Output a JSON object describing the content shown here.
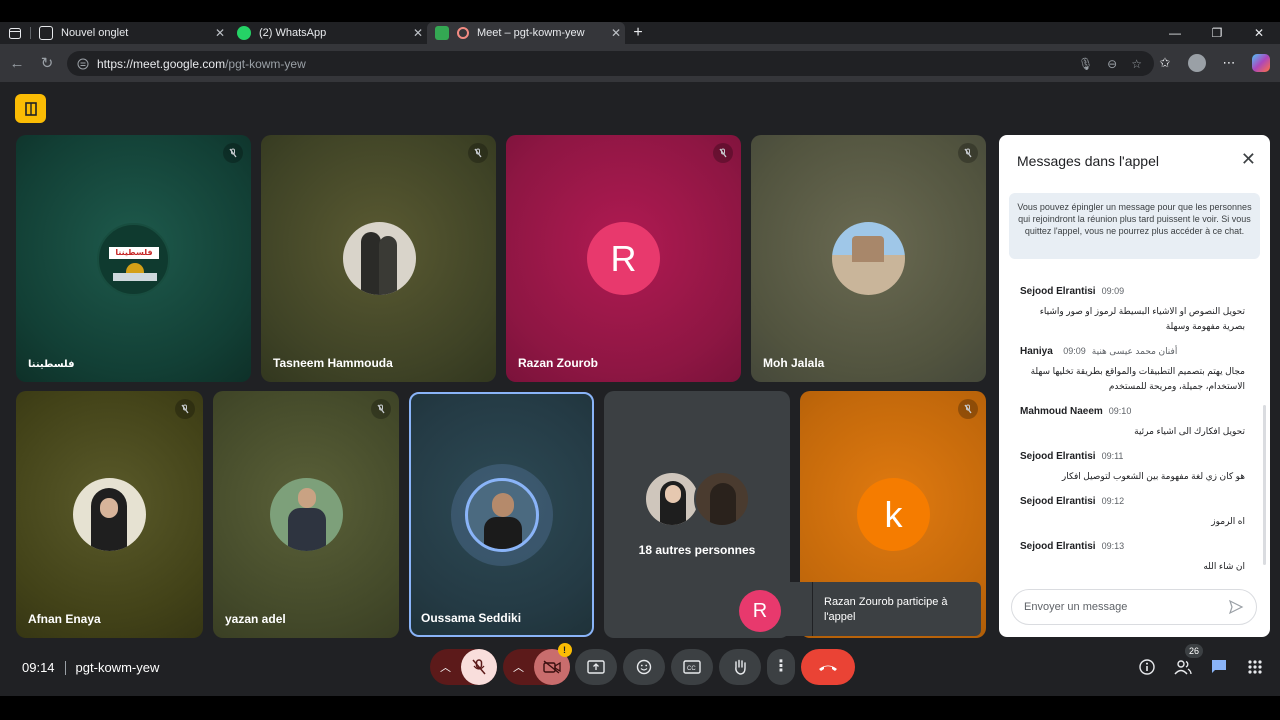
{
  "browser": {
    "tabs": [
      {
        "label": "Nouvel onglet",
        "active": false
      },
      {
        "label": "(2) WhatsApp",
        "active": false
      },
      {
        "label": "Meet – pgt-kowm-yew",
        "active": true
      }
    ],
    "url_host": "https://meet.google.com",
    "url_path": "/pgt-kowm-yew",
    "new_tab": "+"
  },
  "participants": [
    {
      "name": "فلسطيننا",
      "badge_text": "فلسطيننا"
    },
    {
      "name": "Tasneem Hammouda"
    },
    {
      "name": "Razan Zourob",
      "initial": "R"
    },
    {
      "name": "Moh Jalala"
    },
    {
      "name": "Afnan Enaya"
    },
    {
      "name": "yazan adel"
    },
    {
      "name": "Oussama Seddiki"
    },
    {
      "name": "18 autres personnes"
    },
    {
      "name": "",
      "initial": "k"
    }
  ],
  "chat": {
    "title": "Messages dans l'appel",
    "notice": "Vous pouvez épingler un message pour que les personnes qui rejoindront la réunion plus tard puissent le voir. Si vous quittez l'appel, vous ne pourrez plus accéder à ce chat.",
    "messages": [
      {
        "sender": "Sejood Elrantisi",
        "time": "09:09",
        "text": "تحويل النصوص او الاشياء البسيطة لرموز او صور واشياء بصرية مفهومة وسهلة"
      },
      {
        "sender": "Haniya",
        "sender_extra": "أفنان محمد عيسى هنية",
        "time": "09:09",
        "text": "مجال يهتم بتصميم التطبيقات والمواقع بطريقة تخليها سهلة الاستخدام، جميلة، ومريحة للمستخدم"
      },
      {
        "sender": "Mahmoud Naeem",
        "time": "09:10",
        "text": "تحويل افكارك الى اشياء مرئية"
      },
      {
        "sender": "Sejood Elrantisi",
        "time": "09:11",
        "text": "هو كان زي لغة مفهومة بين الشعوب لتوصيل افكار"
      },
      {
        "sender": "Sejood Elrantisi",
        "time": "09:12",
        "text": "اه الرموز"
      },
      {
        "sender": "Sejood Elrantisi",
        "time": "09:13",
        "text": "ان شاء الله"
      }
    ],
    "input_placeholder": "Envoyer un message"
  },
  "toast": {
    "initial": "R",
    "text": "Razan Zourob participe à l'appel"
  },
  "bottom": {
    "time": "09:14",
    "meeting_code": "pgt-kowm-yew",
    "people_count": "26",
    "camera_warning": "!"
  },
  "colors": {
    "accent_pink": "#e8396d",
    "orange": "#f57c00",
    "leave_red": "#ea4335",
    "logo_yellow": "#fbbc04"
  }
}
